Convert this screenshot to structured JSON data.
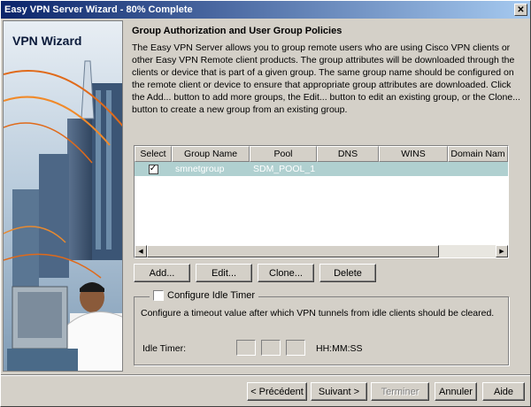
{
  "window": {
    "title": "Easy VPN Server Wizard - 80% Complete",
    "close_glyph": "✕"
  },
  "sidebar": {
    "label": "VPN Wizard"
  },
  "page": {
    "section_title": "Group Authorization and User Group Policies",
    "description": "The Easy VPN Server allows you to group remote users who are using Cisco VPN clients or other Easy VPN Remote client products. The group attributes will be downloaded through the clients or device that is part of a given group. The same group name should be configured on the remote client or device to ensure that appropriate group attributes are downloaded. Click the Add... button to add more groups, the Edit... button to edit an existing group, or the Clone... button to create a new group from an existing group."
  },
  "table": {
    "columns": [
      "Select",
      "Group Name",
      "Pool",
      "DNS",
      "WINS",
      "Domain Nam"
    ],
    "rows": [
      {
        "select_glyph": "✓",
        "group_name": "smnetgroup",
        "pool": "SDM_POOL_1",
        "dns": "",
        "wins": "",
        "domain": ""
      }
    ]
  },
  "table_buttons": {
    "add": "Add...",
    "edit": "Edit...",
    "clone": "Clone...",
    "delete": "Delete"
  },
  "idle_timer": {
    "checkbox_label": "Configure Idle Timer",
    "description": "Configure a timeout value after which VPN tunnels from idle clients should be cleared.",
    "field_label": "Idle Timer:",
    "format": "HH:MM:SS"
  },
  "footer": {
    "previous": "< Précédent",
    "next": "Suivant >",
    "finish": "Terminer",
    "cancel": "Annuler",
    "help": "Aide"
  },
  "scroll": {
    "left_glyph": "◀",
    "right_glyph": "▶"
  }
}
